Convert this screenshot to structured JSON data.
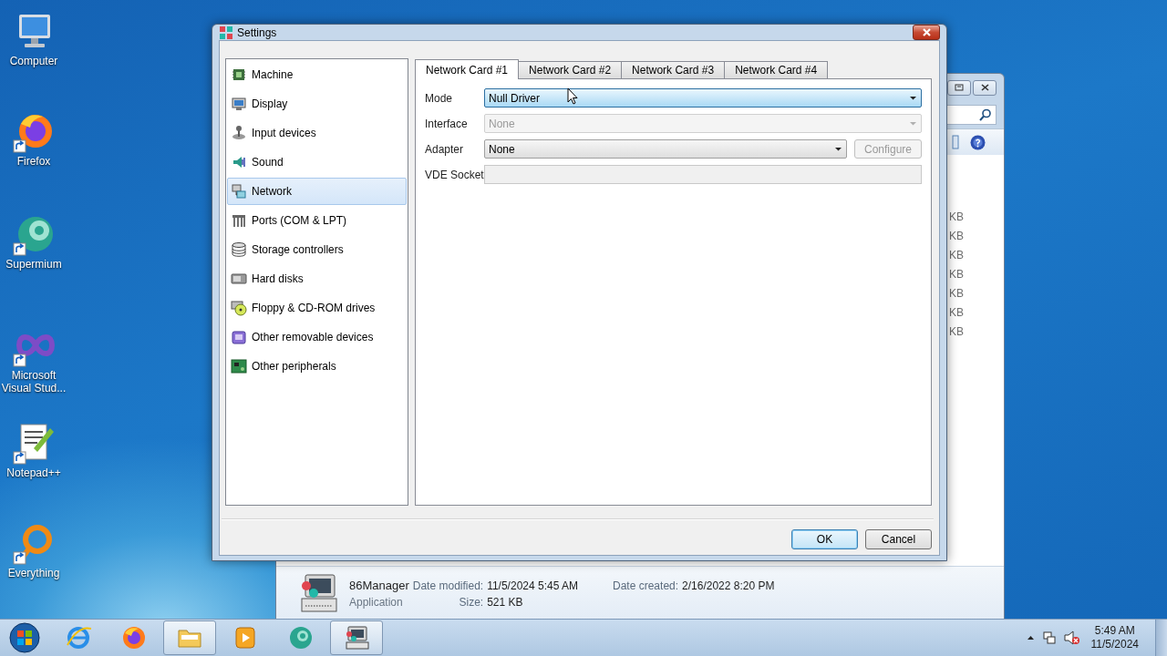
{
  "desktop_icons": [
    {
      "label": "Computer",
      "shortcut": false
    },
    {
      "label": "Firefox",
      "shortcut": true
    },
    {
      "label": "Supermium",
      "shortcut": true
    },
    {
      "label": "Microsoft Visual Stud...",
      "shortcut": true
    },
    {
      "label": "Notepad++",
      "shortcut": true
    },
    {
      "label": "Everything",
      "shortcut": true
    }
  ],
  "background_window": {
    "size_units": [
      "KB",
      "KB",
      "KB",
      "KB",
      "KB",
      "KB",
      "KB"
    ],
    "details": {
      "name": "86Manager",
      "type": "Application",
      "date_modified_label": "Date modified:",
      "date_modified": "11/5/2024 5:45 AM",
      "date_created_label": "Date created:",
      "date_created": "2/16/2022 8:20 PM",
      "size_label": "Size:",
      "size": "521 KB"
    }
  },
  "dialog": {
    "title": "Settings",
    "categories": [
      {
        "label": "Machine",
        "selected": false
      },
      {
        "label": "Display",
        "selected": false
      },
      {
        "label": "Input devices",
        "selected": false
      },
      {
        "label": "Sound",
        "selected": false
      },
      {
        "label": "Network",
        "selected": true
      },
      {
        "label": "Ports (COM & LPT)",
        "selected": false
      },
      {
        "label": "Storage controllers",
        "selected": false
      },
      {
        "label": "Hard disks",
        "selected": false
      },
      {
        "label": "Floppy & CD-ROM drives",
        "selected": false
      },
      {
        "label": "Other removable devices",
        "selected": false
      },
      {
        "label": "Other peripherals",
        "selected": false
      }
    ],
    "tabs": [
      {
        "label": "Network Card #1",
        "selected": true
      },
      {
        "label": "Network Card #2",
        "selected": false
      },
      {
        "label": "Network Card #3",
        "selected": false
      },
      {
        "label": "Network Card #4",
        "selected": false
      }
    ],
    "fields": [
      {
        "kind": "dropdown",
        "label": "Mode",
        "value": "Null Driver",
        "disabled": false,
        "focused": true
      },
      {
        "kind": "dropdown",
        "label": "Interface",
        "value": "None",
        "disabled": true
      },
      {
        "kind": "dropdown",
        "label": "Adapter",
        "value": "None",
        "disabled": false,
        "button": "Configure",
        "button_disabled": true
      },
      {
        "kind": "text",
        "label": "VDE Socket",
        "disabled": true
      }
    ],
    "buttons": [
      {
        "label": "OK",
        "default": true
      },
      {
        "label": "Cancel",
        "default": false
      }
    ]
  },
  "taskbar": {
    "apps": [
      {
        "running": false
      },
      {
        "running": false
      },
      {
        "running": true
      },
      {
        "running": false
      },
      {
        "running": false
      },
      {
        "running": true
      }
    ],
    "clock": {
      "time": "5:49 AM",
      "date": "11/5/2024"
    }
  }
}
